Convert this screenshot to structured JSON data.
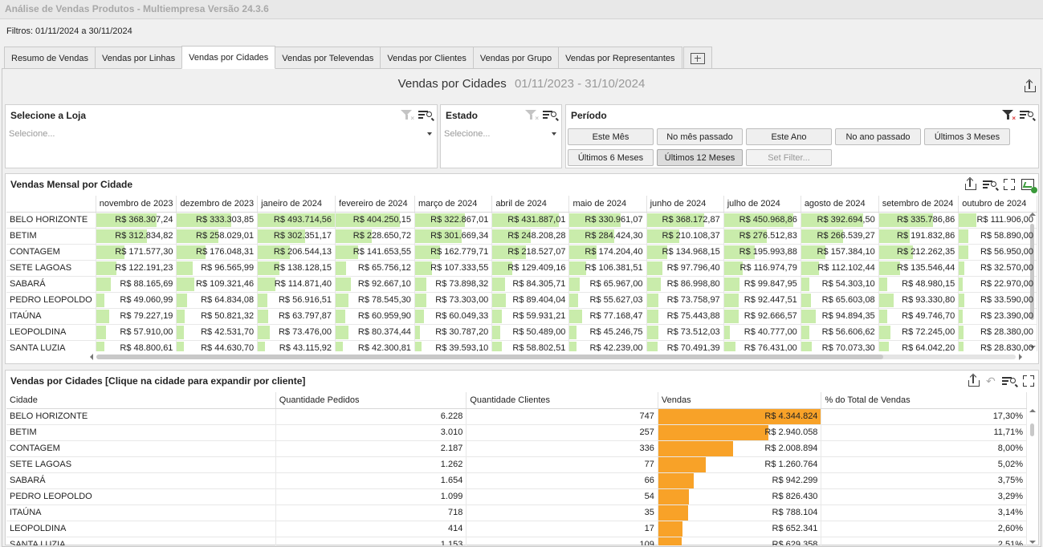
{
  "window": {
    "title": "Análise de Vendas Produtos - Multiempresa Versão 24.3.6"
  },
  "filters_label": "Filtros: 01/11/2024 a 30/11/2024",
  "tabs": [
    {
      "label": "Resumo de Vendas",
      "active": false
    },
    {
      "label": "Vendas por Linhas",
      "active": false
    },
    {
      "label": "Vendas por Cidades",
      "active": true
    },
    {
      "label": "Vendas por Televendas",
      "active": false
    },
    {
      "label": "Vendas por Clientes",
      "active": false
    },
    {
      "label": "Vendas por Grupo",
      "active": false
    },
    {
      "label": "Vendas por Representantes",
      "active": false
    }
  ],
  "dashboard": {
    "title": "Vendas por Cidades",
    "date_range": "01/11/2023 - 31/10/2024"
  },
  "store_filter": {
    "title": "Selecione a Loja",
    "placeholder": "Selecione..."
  },
  "state_filter": {
    "title": "Estado",
    "placeholder": "Selecione..."
  },
  "period_filter": {
    "title": "Período",
    "buttons": [
      "Este Mês",
      "No mês passado",
      "Este Ano",
      "No ano passado",
      "Últimos 3 Meses",
      "Últimos 6 Meses",
      "Últimos 12 Meses",
      "Set Filter..."
    ],
    "selected": "Últimos 12 Meses"
  },
  "colors": {
    "green_bar": "#c9ecab",
    "orange_bar": "#f8a228"
  },
  "monthly_table": {
    "title": "Vendas Mensal por Cidade",
    "months": [
      "novembro de 2023",
      "dezembro de 2023",
      "janeiro de 2024",
      "fevereiro de 2024",
      "março de 2024",
      "abril de 2024",
      "maio de 2024",
      "junho de 2024",
      "julho de 2024",
      "agosto de 2024",
      "setembro de 2024",
      "outubro de 2024"
    ],
    "rows": [
      {
        "city": "BELO HORIZONTE",
        "values": [
          "R$ 368.307,24",
          "R$ 333.303,85",
          "R$ 493.714,56",
          "R$ 404.250,15",
          "R$ 322.867,01",
          "R$ 431.887,01",
          "R$ 330.961,07",
          "R$ 368.172,87",
          "R$ 450.968,86",
          "R$ 392.694,50",
          "R$ 335.786,86",
          "R$ 111.906,00"
        ],
        "fills": [
          0.75,
          0.68,
          1.0,
          0.82,
          0.65,
          0.87,
          0.67,
          0.75,
          0.91,
          0.8,
          0.68,
          0.23
        ]
      },
      {
        "city": "BETIM",
        "values": [
          "R$ 312.834,82",
          "R$ 258.029,01",
          "R$ 302.351,17",
          "R$ 228.650,72",
          "R$ 301.669,34",
          "R$ 248.208,28",
          "R$ 284.424,30",
          "R$ 210.108,37",
          "R$ 276.512,83",
          "R$ 266.539,27",
          "R$ 191.832,86",
          "R$ 58.890,00"
        ],
        "fills": [
          0.63,
          0.52,
          0.61,
          0.46,
          0.61,
          0.5,
          0.58,
          0.43,
          0.56,
          0.54,
          0.39,
          0.12
        ]
      },
      {
        "city": "CONTAGEM",
        "values": [
          "R$ 171.577,30",
          "R$ 176.048,31",
          "R$ 206.544,13",
          "R$ 141.653,55",
          "R$ 162.779,71",
          "R$ 218.527,07",
          "R$ 174.204,40",
          "R$ 134.968,15",
          "R$ 195.993,88",
          "R$ 157.384,10",
          "R$ 212.262,35",
          "R$ 56.950,00"
        ],
        "fills": [
          0.35,
          0.36,
          0.42,
          0.29,
          0.33,
          0.44,
          0.35,
          0.27,
          0.4,
          0.32,
          0.43,
          0.12
        ]
      },
      {
        "city": "SETE LAGOAS",
        "values": [
          "R$ 122.191,23",
          "R$ 96.565,99",
          "R$ 138.128,15",
          "R$ 65.756,12",
          "R$ 107.333,55",
          "R$ 129.409,16",
          "R$ 106.381,51",
          "R$ 97.796,40",
          "R$ 116.974,79",
          "R$ 112.102,44",
          "R$ 135.546,44",
          "R$ 32.570,00"
        ],
        "fills": [
          0.25,
          0.2,
          0.28,
          0.13,
          0.22,
          0.26,
          0.22,
          0.2,
          0.24,
          0.23,
          0.27,
          0.07
        ]
      },
      {
        "city": "SABARÁ",
        "values": [
          "R$ 88.165,69",
          "R$ 109.321,46",
          "R$ 114.871,40",
          "R$ 92.667,10",
          "R$ 73.898,32",
          "R$ 84.305,71",
          "R$ 65.967,00",
          "R$ 86.998,80",
          "R$ 99.847,95",
          "R$ 54.303,10",
          "R$ 48.980,15",
          "R$ 22.970,00"
        ],
        "fills": [
          0.18,
          0.22,
          0.23,
          0.19,
          0.15,
          0.17,
          0.13,
          0.18,
          0.2,
          0.11,
          0.1,
          0.05
        ]
      },
      {
        "city": "PEDRO LEOPOLDO",
        "values": [
          "R$ 49.060,99",
          "R$ 64.834,08",
          "R$ 56.916,51",
          "R$ 78.545,30",
          "R$ 73.303,00",
          "R$ 89.404,04",
          "R$ 55.627,03",
          "R$ 73.758,97",
          "R$ 92.447,51",
          "R$ 65.603,08",
          "R$ 93.330,80",
          "R$ 33.590,00"
        ],
        "fills": [
          0.1,
          0.13,
          0.12,
          0.16,
          0.15,
          0.18,
          0.11,
          0.15,
          0.19,
          0.13,
          0.19,
          0.07
        ]
      },
      {
        "city": "ITAÚNA",
        "values": [
          "R$ 79.227,19",
          "R$ 50.821,32",
          "R$ 63.797,87",
          "R$ 60.959,90",
          "R$ 60.049,33",
          "R$ 59.931,21",
          "R$ 77.168,47",
          "R$ 75.443,88",
          "R$ 92.666,57",
          "R$ 94.894,35",
          "R$ 49.746,70",
          "R$ 23.390,00"
        ],
        "fills": [
          0.16,
          0.1,
          0.13,
          0.12,
          0.12,
          0.12,
          0.16,
          0.15,
          0.19,
          0.19,
          0.1,
          0.05
        ]
      },
      {
        "city": "LEOPOLDINA",
        "values": [
          "R$ 57.910,00",
          "R$ 42.531,70",
          "R$ 73.476,00",
          "R$ 80.374,44",
          "R$ 30.787,20",
          "R$ 50.489,00",
          "R$ 45.246,75",
          "R$ 73.512,03",
          "R$ 40.777,00",
          "R$ 56.606,62",
          "R$ 72.245,00",
          "R$ 28.380,00"
        ],
        "fills": [
          0.12,
          0.09,
          0.15,
          0.16,
          0.06,
          0.1,
          0.09,
          0.15,
          0.08,
          0.11,
          0.15,
          0.06
        ]
      },
      {
        "city": "SANTA LUZIA",
        "values": [
          "R$ 48.800,61",
          "R$ 44.630,70",
          "R$ 43.115,92",
          "R$ 42.300,81",
          "R$ 39.593,10",
          "R$ 58.802,51",
          "R$ 42.239,00",
          "R$ 70.491,39",
          "R$ 76.431,00",
          "R$ 70.073,30",
          "R$ 64.042,20",
          "R$ 28.830,00"
        ],
        "fills": [
          0.1,
          0.09,
          0.09,
          0.09,
          0.08,
          0.12,
          0.09,
          0.14,
          0.15,
          0.14,
          0.13,
          0.06
        ]
      }
    ]
  },
  "city_table": {
    "title": "Vendas por Cidades [Clique na cidade para expandir por cliente]",
    "columns": [
      "Cidade",
      "Quantidade Pedidos",
      "Quantidade Clientes",
      "Vendas",
      "% do Total de Vendas"
    ],
    "rows": [
      {
        "city": "BELO HORIZONTE",
        "orders": "6.228",
        "clients": "747",
        "sales": "R$ 4.344.824",
        "pct": "17,30%",
        "fill": 1.0
      },
      {
        "city": "BETIM",
        "orders": "3.010",
        "clients": "257",
        "sales": "R$ 2.940.058",
        "pct": "11,71%",
        "fill": 0.677
      },
      {
        "city": "CONTAGEM",
        "orders": "2.187",
        "clients": "336",
        "sales": "R$ 2.008.894",
        "pct": "8,00%",
        "fill": 0.462
      },
      {
        "city": "SETE LAGOAS",
        "orders": "1.262",
        "clients": "77",
        "sales": "R$ 1.260.764",
        "pct": "5,02%",
        "fill": 0.29
      },
      {
        "city": "SABARÁ",
        "orders": "1.654",
        "clients": "66",
        "sales": "R$ 942.299",
        "pct": "3,75%",
        "fill": 0.217
      },
      {
        "city": "PEDRO LEOPOLDO",
        "orders": "1.099",
        "clients": "54",
        "sales": "R$ 826.430",
        "pct": "3,29%",
        "fill": 0.19
      },
      {
        "city": "ITAÚNA",
        "orders": "718",
        "clients": "35",
        "sales": "R$ 788.104",
        "pct": "3,14%",
        "fill": 0.181
      },
      {
        "city": "LEOPOLDINA",
        "orders": "414",
        "clients": "17",
        "sales": "R$ 652.341",
        "pct": "2,60%",
        "fill": 0.15
      },
      {
        "city": "SANTA LUZIA",
        "orders": "1.153",
        "clients": "109",
        "sales": "R$ 629.358",
        "pct": "2,51%",
        "fill": 0.145
      }
    ]
  }
}
